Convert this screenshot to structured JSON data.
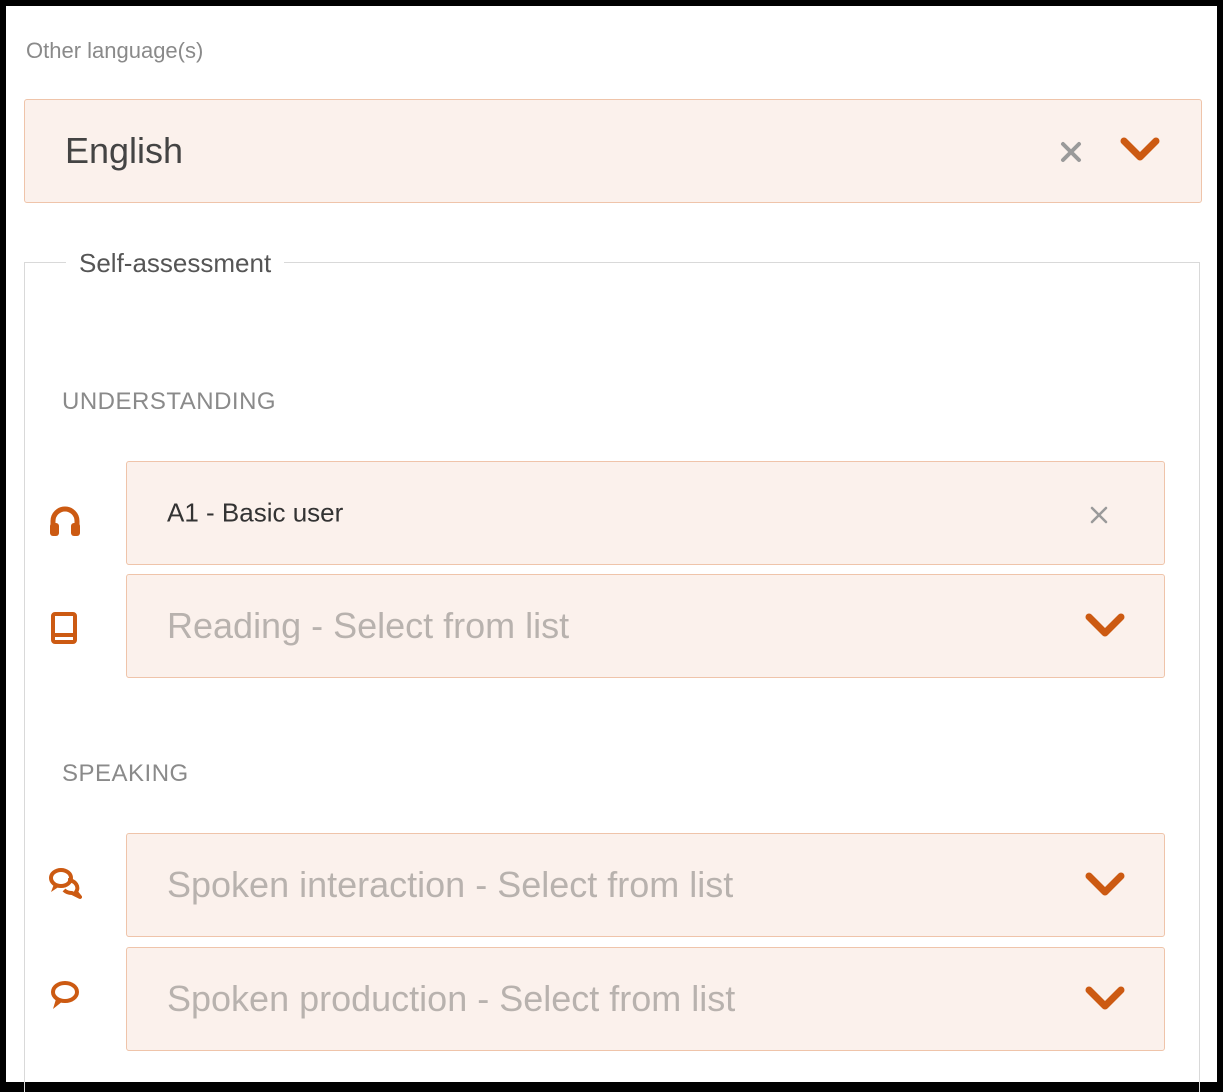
{
  "language": {
    "label": "Other language(s)",
    "value": "English"
  },
  "self_assessment": {
    "legend": "Self-assessment",
    "understanding": {
      "label": "UNDERSTANDING",
      "listening": {
        "value": "A1 - Basic user",
        "icon": "headphones-icon"
      },
      "reading": {
        "placeholder": "Reading - Select from list",
        "icon": "book-icon"
      }
    },
    "speaking": {
      "label": "SPEAKING",
      "interaction": {
        "placeholder": "Spoken interaction - Select from list",
        "icon": "conversation-icon"
      },
      "production": {
        "placeholder": "Spoken production - Select from list",
        "icon": "speech-bubble-icon"
      }
    }
  },
  "colors": {
    "accent": "#cc5a12",
    "field_bg": "#fbf1ec",
    "field_border": "#efc4aa"
  }
}
